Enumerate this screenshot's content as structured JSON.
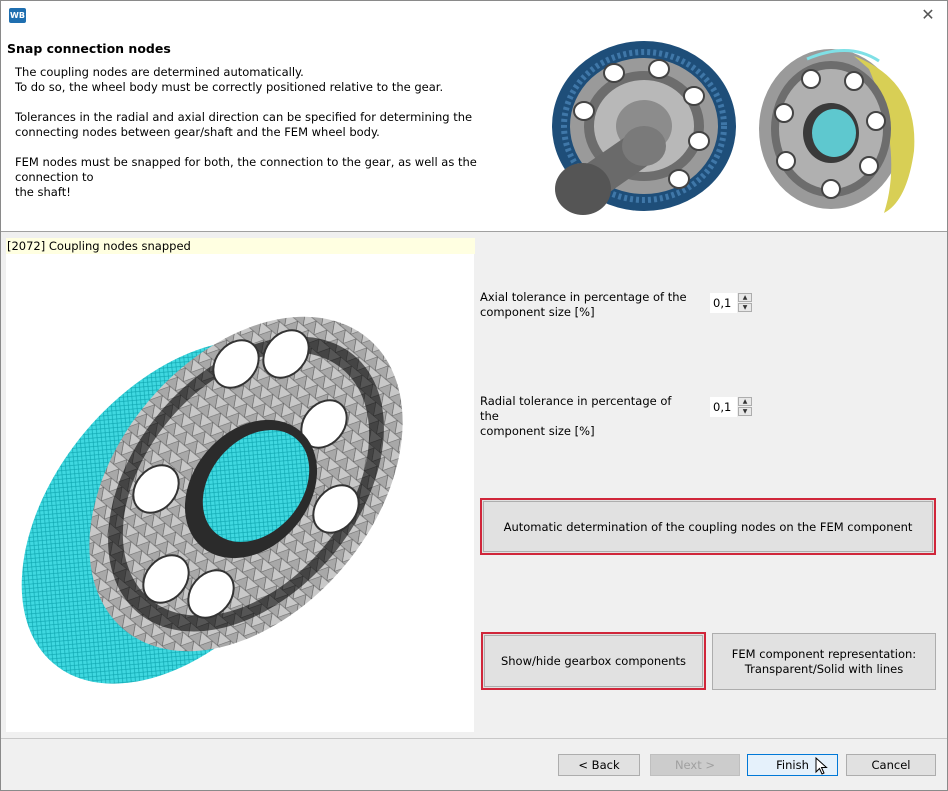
{
  "window": {
    "app_icon_text": "WB"
  },
  "header": {
    "title": "Snap connection nodes",
    "description": [
      "The coupling nodes are determined automatically.\nTo do so, the wheel body must be correctly positioned relative to the gear.",
      "Tolerances in the radial and axial direction can be specified for determining the\nconnecting nodes between gear/shaft and the FEM wheel body.",
      "FEM nodes must be snapped for both, the connection to the gear, as well as the connection to\nthe shaft!"
    ]
  },
  "status": {
    "message": "[2072] Coupling nodes snapped"
  },
  "settings": {
    "axial": {
      "label": "Axial tolerance in percentage of the\ncomponent size [%]",
      "value": "0,1"
    },
    "radial": {
      "label": "Radial tolerance in percentage of the\ncomponent size [%]",
      "value": "0,1"
    },
    "auto_button": "Automatic determination of the coupling nodes on the FEM component",
    "show_hide_button": "Show/hide gearbox components",
    "representation_button": "FEM component representation:\nTransparent/Solid with lines"
  },
  "footer": {
    "back": "< Back",
    "next": "Next >",
    "finish": "Finish",
    "cancel": "Cancel"
  },
  "colors": {
    "highlight_border": "#d0263a",
    "mesh_cyan": "#00e5ee",
    "gear_blue": "#1e4e79",
    "gear_yellow": "#d8cf55"
  }
}
